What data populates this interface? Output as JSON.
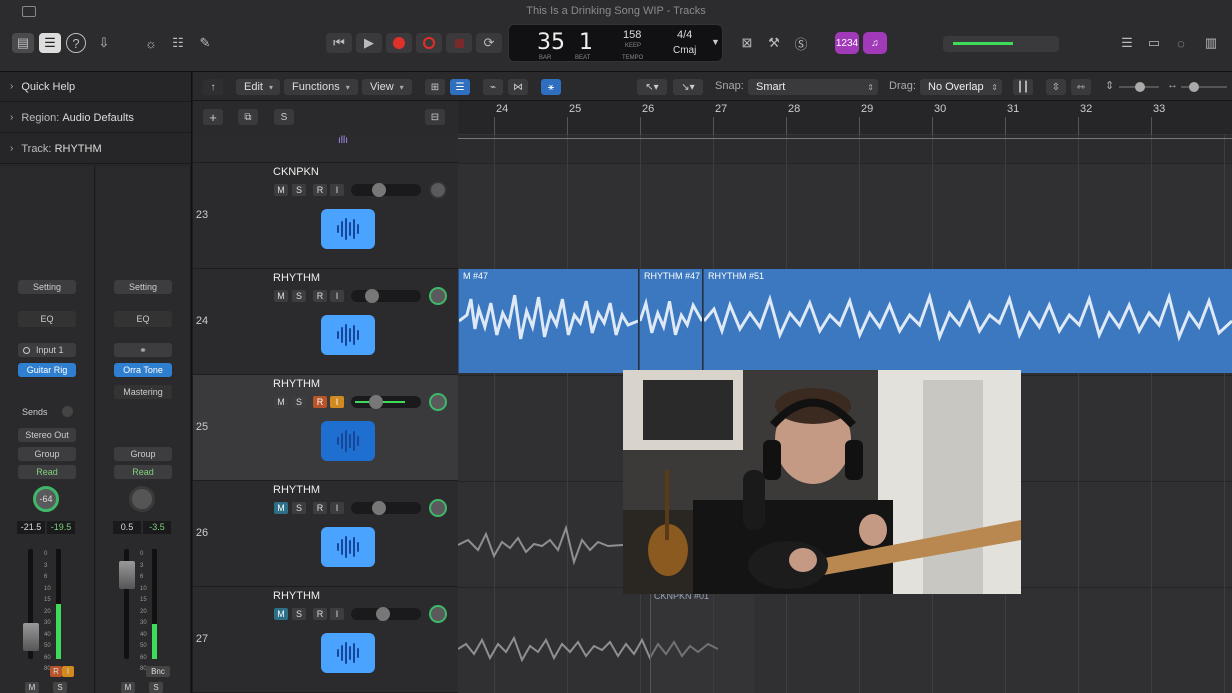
{
  "window": {
    "title": "This Is a Drinking Song WIP - Tracks"
  },
  "lcd": {
    "bar": "35",
    "beat": "1",
    "bar_label": "BAR",
    "beat_label": "BEAT",
    "tempo": "158",
    "tempo_mode": "KEEP",
    "tempo_label": "TEMPO",
    "signature": "4/4",
    "key": "Cmaj"
  },
  "count_in": "1234",
  "inspector": {
    "quick_help": "Quick Help",
    "region_label": "Region:",
    "region_value": "Audio Defaults",
    "track_label": "Track:",
    "track_value": "RHYTHM"
  },
  "strip1": {
    "setting": "Setting",
    "eq": "EQ",
    "input": "Input 1",
    "plugin": "Guitar Rig",
    "sends": "Sends",
    "output": "Stereo Out",
    "group": "Group",
    "automation": "Read",
    "pan": "-64",
    "peak": "-21.5",
    "gain": "-19.5",
    "m": "M",
    "s": "S",
    "r": "R",
    "i": "I"
  },
  "strip2": {
    "setting": "Setting",
    "eq": "EQ",
    "plugin": "Orra Tone",
    "plugin2": "Mastering",
    "group": "Group",
    "automation": "Read",
    "peak": "0.5",
    "gain": "-3.5",
    "bnc": "Bnc",
    "m": "M",
    "s": "S"
  },
  "fader_scale": [
    "0",
    "3",
    "6",
    "10",
    "15",
    "20",
    "30",
    "40",
    "50",
    "60",
    "80"
  ],
  "toolbar": {
    "edit": "Edit",
    "functions": "Functions",
    "view": "View",
    "snap_label": "Snap:",
    "snap_value": "Smart",
    "drag_label": "Drag:",
    "drag_value": "No Overlap"
  },
  "track_header": {
    "add": "+",
    "solo": "S"
  },
  "ruler": [
    "24",
    "25",
    "26",
    "27",
    "28",
    "29",
    "30",
    "31",
    "32",
    "33"
  ],
  "tracks": [
    {
      "num": "23",
      "name": "CKNPKN",
      "m": "M",
      "s": "S",
      "r": "R",
      "i": "I",
      "volume": 0.3
    },
    {
      "num": "24",
      "name": "RHYTHM",
      "m": "M",
      "s": "S",
      "r": "R",
      "i": "I",
      "volume": 0.2
    },
    {
      "num": "25",
      "name": "RHYTHM",
      "m": "M",
      "s": "S",
      "r": "R",
      "i": "I",
      "volume": 0.25
    },
    {
      "num": "26",
      "name": "RHYTHM",
      "m": "M",
      "s": "S",
      "r": "R",
      "i": "I",
      "volume": 0.3
    },
    {
      "num": "27",
      "name": "RHYTHM",
      "m": "M",
      "s": "S",
      "r": "R",
      "i": "I",
      "volume": 0.35
    }
  ],
  "regions": {
    "r1": "M #47",
    "r2": "RHYTHM #47",
    "r3": "RHYTHM #51",
    "r4": "CKNPKN #01"
  },
  "colors": {
    "accent": "#2f7fd0",
    "region": "#3b78c0",
    "record": "#e0302a",
    "meter": "#3fdc5a",
    "badge": "#a03ab8"
  }
}
